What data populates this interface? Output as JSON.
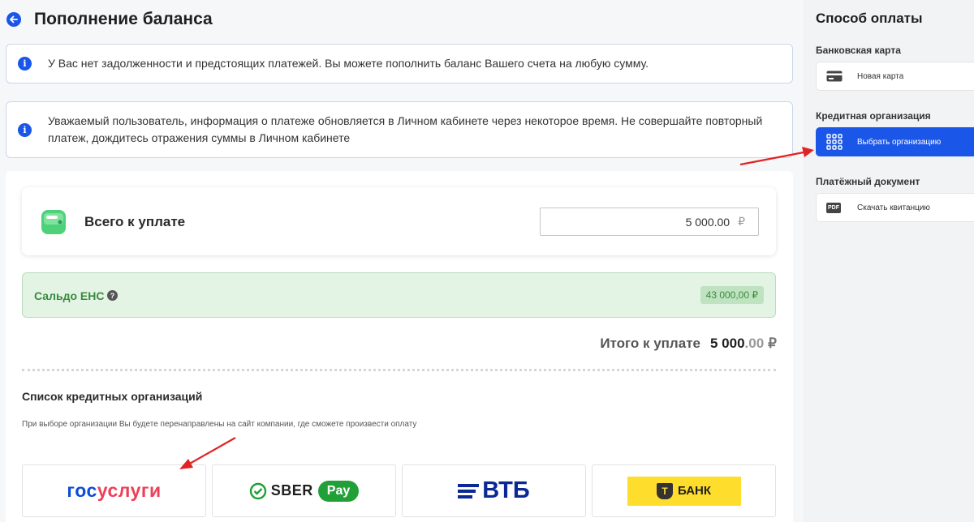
{
  "header": {
    "title": "Пополнение баланса"
  },
  "notices": [
    {
      "text": "У Вас нет задолженности и предстоящих платежей. Вы можете пополнить баланс Вашего счета на любую сумму."
    },
    {
      "text": "Уважаемый пользователь, информация о платеже обновляется в Личном кабинете через некоторое время. Не совершайте повторный платеж, дождитесь отражения суммы в Личном кабинете"
    }
  ],
  "payment": {
    "total_label": "Всего к уплате",
    "amount": "5 000.00",
    "currency_symbol": "₽"
  },
  "saldo": {
    "label": "Сальдо ЕНС",
    "value": "43 000,00 ₽"
  },
  "grand_total": {
    "label": "Итого к уплате",
    "integer": "5 000",
    "decimal": ".00",
    "currency": "₽"
  },
  "orgs": {
    "title": "Список кредитных организаций",
    "subtitle": "При выборе организации Вы будете перенаправлены на сайт компании, где сможете произвести оплату",
    "items": [
      {
        "logo_a": "гос",
        "logo_b": "услуги"
      },
      {
        "logo": "SBER",
        "pill": "Pay"
      },
      {
        "logo": "ВТБ"
      },
      {
        "glyph": "Т",
        "logo": "БАНК"
      }
    ]
  },
  "sidebar": {
    "title": "Способ оплаты",
    "sections": [
      {
        "label": "Банковская карта",
        "button": "Новая карта",
        "icon": "card-icon"
      },
      {
        "label": "Кредитная организация",
        "button": "Выбрать организацию",
        "icon": "grid-icon",
        "active": true
      },
      {
        "label": "Платёжный документ",
        "button": "Скачать квитанцию",
        "icon": "pdf-icon",
        "icon_text": "PDF"
      }
    ]
  },
  "colors": {
    "accent": "#1a56e8",
    "success": "#3a8a3f",
    "annotation_arrow": "#e02424"
  }
}
